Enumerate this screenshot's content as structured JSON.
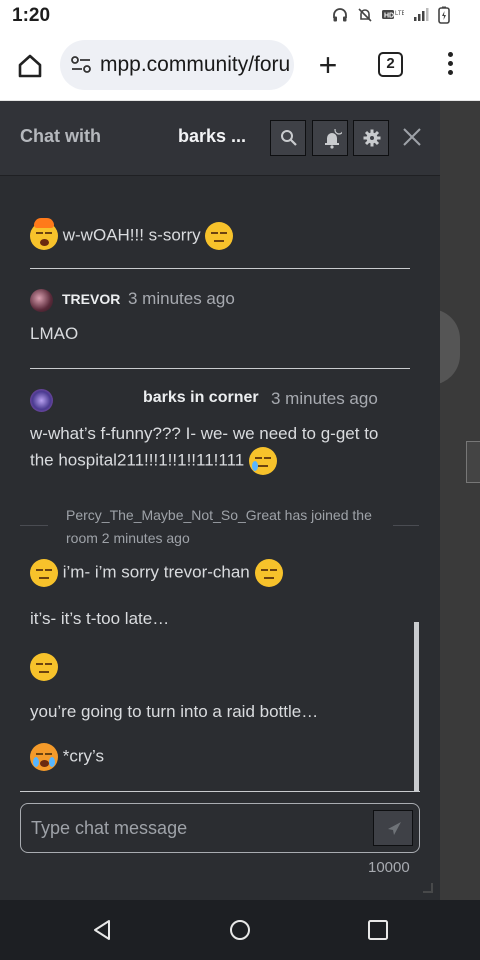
{
  "status": {
    "time": "1:20",
    "icons": [
      "headphones-icon",
      "bell-off-icon",
      "hd-lte-icon",
      "signal-icon",
      "battery-icon"
    ]
  },
  "browser": {
    "url": "mpp.community/foru",
    "tab_count": "2"
  },
  "chat": {
    "title_label": "Chat with",
    "title_name": "barks ...",
    "messages": [
      {
        "type": "text",
        "emoji": "exploding-head",
        "text": "w-wOAH!!! s-sorry",
        "trailing_emoji": "pensive"
      },
      {
        "type": "header",
        "author": "TREVOR",
        "time": "3 minutes ago"
      },
      {
        "type": "text",
        "text": "LMAO"
      },
      {
        "type": "header",
        "author": "barks in corner",
        "time": "3 minutes ago"
      },
      {
        "type": "text",
        "text": "w-what’s f-funny??? I- we- we need to g-get to"
      },
      {
        "type": "text",
        "text": "the hospital211!!!1!!1!!11!111",
        "trailing_emoji": "crying"
      },
      {
        "type": "system",
        "text": "Percy_The_Maybe_Not_So_Great has joined the room 2 minutes ago"
      },
      {
        "type": "text",
        "emoji": "pensive",
        "text": "i’m- i’m sorry trevor-chan",
        "trailing_emoji": "pensive"
      },
      {
        "type": "text",
        "text": "it’s- it’s t-too late…"
      },
      {
        "type": "emoji",
        "emoji": "pensive"
      },
      {
        "type": "text",
        "text": "you’re going to turn into a raid bottle…"
      },
      {
        "type": "text",
        "emoji": "loudly-crying",
        "text": "*cry’s"
      }
    ],
    "composer": {
      "placeholder": "Type chat message",
      "counter": "10000"
    }
  }
}
